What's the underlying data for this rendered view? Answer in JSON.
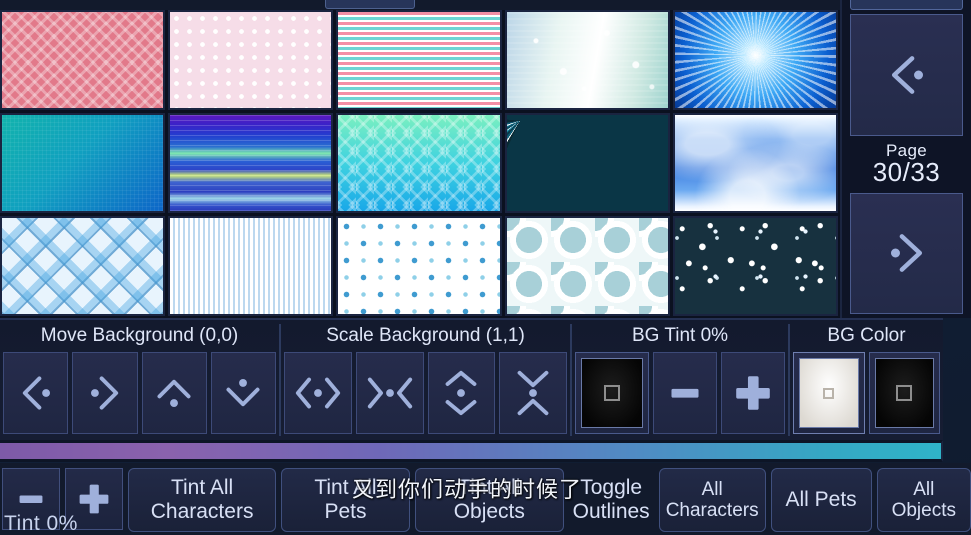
{
  "page_nav": {
    "prev_icon": "chevron-left-dot-icon",
    "next_icon": "chevron-right-dot-icon",
    "label_word": "Page",
    "value": "30/33",
    "current": 30,
    "total": 33
  },
  "background_grid": {
    "rows": 3,
    "columns": 5,
    "thumbnails": [
      {
        "name": "pink-greek-key",
        "art": "art-greek"
      },
      {
        "name": "pink-polka-dots",
        "art": "art-dots"
      },
      {
        "name": "pink-teal-stripes",
        "art": "art-stripes-pink"
      },
      {
        "name": "sparkle-bokeh",
        "art": "art-bokeh"
      },
      {
        "name": "blue-sunburst",
        "art": "art-sunburst"
      },
      {
        "name": "teal-gradient",
        "art": "art-teal-grad"
      },
      {
        "name": "spectrum-streaks",
        "art": "art-spectrum"
      },
      {
        "name": "teal-chevron-zigzag",
        "art": "art-chevron"
      },
      {
        "name": "blue-light-rays",
        "art": "art-rays"
      },
      {
        "name": "blue-watercolor-clouds",
        "art": "art-watercolor"
      },
      {
        "name": "blue-plaid",
        "art": "art-plaid"
      },
      {
        "name": "blue-pinstripes",
        "art": "art-pinstripe"
      },
      {
        "name": "snowflakes",
        "art": "art-snowflake"
      },
      {
        "name": "bubble-circles",
        "art": "art-circles"
      },
      {
        "name": "starry-night",
        "art": "art-stars"
      }
    ]
  },
  "toolbar": {
    "move_background": {
      "title": "Move Background (0,0)",
      "offset_x": 0,
      "offset_y": 0,
      "buttons": [
        {
          "name": "move-left-button",
          "icon": "chevron-left-dot-icon"
        },
        {
          "name": "move-right-button",
          "icon": "chevron-right-dot-icon"
        },
        {
          "name": "move-up-button",
          "icon": "chevron-up-dot-icon"
        },
        {
          "name": "move-down-button",
          "icon": "chevron-down-dot-icon"
        }
      ]
    },
    "scale_background": {
      "title": "Scale Background (1,1)",
      "scale_x": 1,
      "scale_y": 1,
      "buttons": [
        {
          "name": "expand-horizontal-button",
          "icon": "expand-horizontal-icon"
        },
        {
          "name": "shrink-horizontal-button",
          "icon": "shrink-horizontal-icon"
        },
        {
          "name": "expand-vertical-button",
          "icon": "expand-vertical-icon"
        },
        {
          "name": "shrink-vertical-button",
          "icon": "shrink-vertical-icon"
        }
      ]
    },
    "bg_tint": {
      "title": "BG Tint 0%",
      "percent": 0,
      "swatch_color": "#0a0a0a",
      "decrease_label": "minus-icon",
      "increase_label": "plus-icon"
    },
    "bg_color": {
      "title": "BG Color",
      "swatches": [
        {
          "name": "bg-color-white-swatch",
          "color": "#ffffff",
          "selected": true
        },
        {
          "name": "bg-color-black-swatch",
          "color": "#0a0a0a",
          "selected": false
        }
      ]
    }
  },
  "bottom_bar": {
    "tint_minus": "minus-icon",
    "tint_plus": "plus-icon",
    "tint_label": "Tint 0%",
    "tint_percent": 0,
    "buttons": [
      {
        "name": "tint-all-characters-button",
        "line1": "Tint All",
        "line2": "Characters"
      },
      {
        "name": "tint-all-pets-button",
        "line1": "Tint All",
        "line2": "Pets"
      },
      {
        "name": "tint-all-objects-button",
        "line1": "Tint All",
        "line2": "Objects"
      },
      {
        "name": "toggle-outlines-button",
        "line1": "Toggle",
        "line2": "Outlines"
      },
      {
        "name": "all-characters-button",
        "line1": "All",
        "line2": "Characters"
      },
      {
        "name": "all-pets-button",
        "line1": "All Pets",
        "line2": ""
      },
      {
        "name": "all-objects-button",
        "line1": "All",
        "line2": "Objects"
      }
    ]
  },
  "overlay": {
    "chinese_text": "又到你们动手的时候了"
  }
}
